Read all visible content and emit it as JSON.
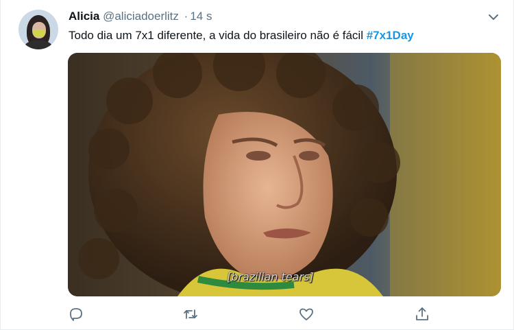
{
  "tweet": {
    "author_name": "Alicia",
    "handle": "@aliciadoerlitz",
    "separator": "·",
    "time": "14 s",
    "text": "Todo dia um 7x1 diferente, a vida do brasileiro não é fácil",
    "hashtag": "#7x1Day",
    "media_caption": "[brazilian tears]"
  },
  "icons": {
    "menu": "chevron-down-icon",
    "reply": "reply-icon",
    "retweet": "retweet-icon",
    "like": "heart-icon",
    "share": "share-icon"
  },
  "colors": {
    "hashtag": "#1b95e0",
    "secondary_text": "#5b7083",
    "icon": "#5b7083"
  }
}
